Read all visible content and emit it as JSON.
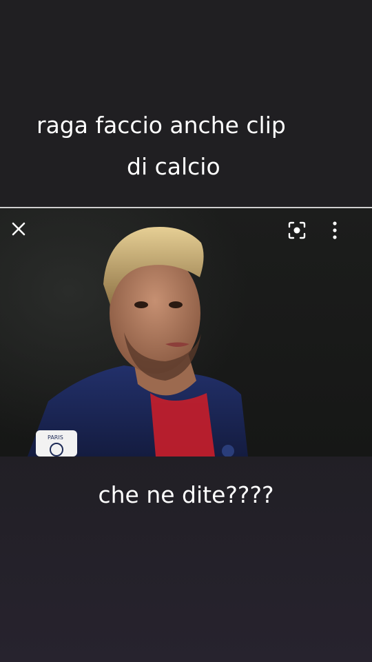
{
  "top_caption": {
    "line1": "raga faccio anche clip",
    "line2": "di calcio"
  },
  "image_viewer": {
    "close_icon": "close-icon",
    "lens_icon": "lens-icon",
    "more_icon": "more-vertical-icon",
    "badge_text": "PARIS"
  },
  "bottom_caption": {
    "text": "che ne dite????"
  },
  "colors": {
    "background": "#201f22",
    "text": "#ffffff",
    "jersey_navy": "#1d2a56",
    "jersey_red": "#d0202a"
  }
}
